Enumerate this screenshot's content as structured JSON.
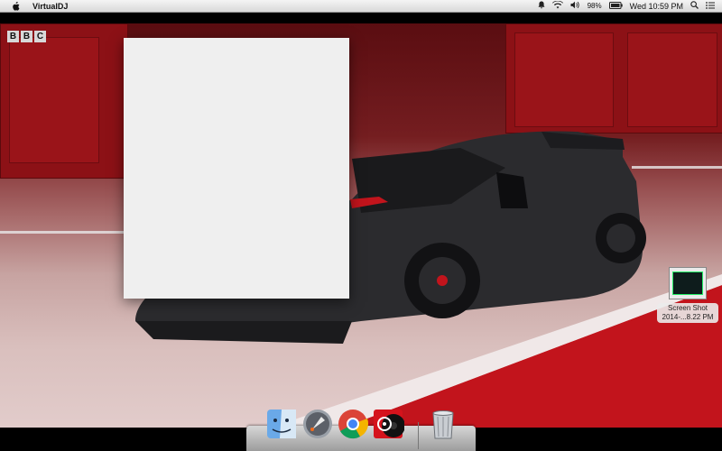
{
  "menubar": {
    "app_name": "VirtualDJ",
    "battery_percent": "98%",
    "clock": "Wed 10:59 PM"
  },
  "wallpaper": {
    "logo_letters": [
      "B",
      "B",
      "C"
    ]
  },
  "desktop_items": [
    {
      "label_line1": "Screen Shot",
      "label_line2": "2014-...8.22 PM"
    }
  ],
  "dock": {
    "items": [
      {
        "icon": "finder-icon"
      },
      {
        "icon": "launchpad-icon"
      },
      {
        "icon": "chrome-icon"
      },
      {
        "icon": "music-app-icon"
      },
      {
        "icon": "trash-icon"
      }
    ]
  },
  "colors": {
    "menubar_bg": "#e6e6e6",
    "wall_red": "#8c1116",
    "track_red": "#c2141c",
    "window_bg": "#efefef"
  }
}
